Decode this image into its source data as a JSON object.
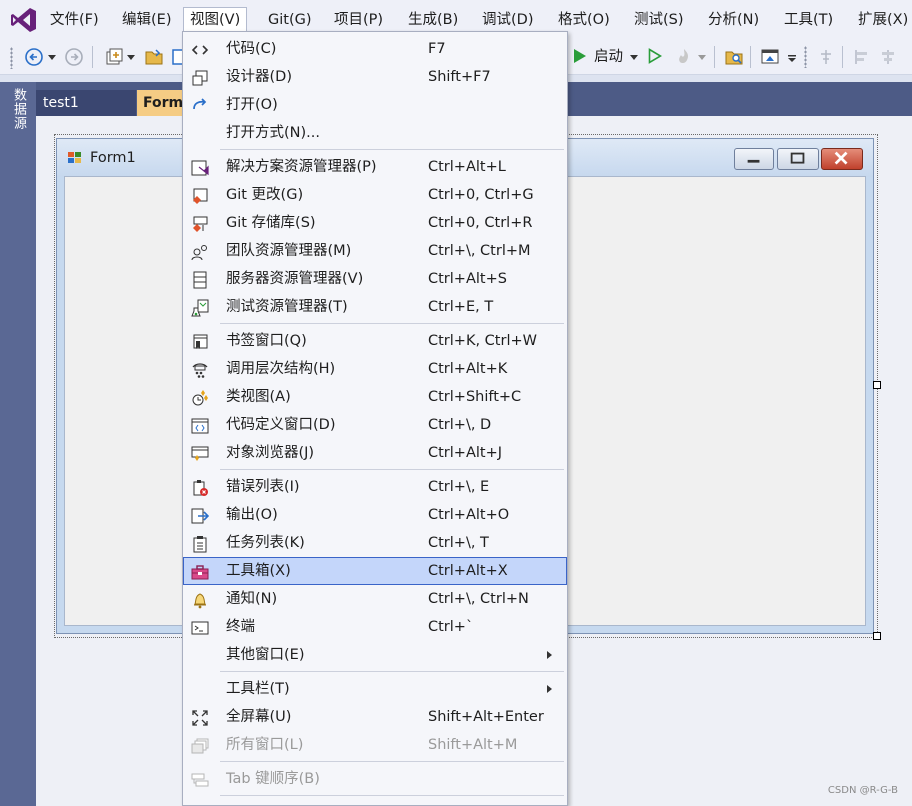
{
  "menubar": {
    "items": [
      "文件(F)",
      "编辑(E)",
      "视图(V)",
      "Git(G)",
      "项目(P)",
      "生成(B)",
      "调试(D)",
      "格式(O)",
      "测试(S)",
      "分析(N)",
      "工具(T)",
      "扩展(X)"
    ],
    "active_index": 2
  },
  "toolbar": {
    "start_label": "启动"
  },
  "left_panel": {
    "datasource_label": "数据源"
  },
  "tabs": {
    "tab1": "test1",
    "tab2": "Form"
  },
  "form": {
    "title": "Form1"
  },
  "view_menu": {
    "items": [
      {
        "label": "代码(C)",
        "shortcut": "F7",
        "icon": "code-icon"
      },
      {
        "label": "设计器(D)",
        "shortcut": "Shift+F7",
        "icon": "designer-icon"
      },
      {
        "label": "打开(O)",
        "shortcut": "",
        "icon": "open-icon"
      },
      {
        "label": "打开方式(N)...",
        "shortcut": "",
        "icon": ""
      },
      {
        "label": "解决方案资源管理器(P)",
        "shortcut": "Ctrl+Alt+L",
        "icon": "solution-explorer-icon"
      },
      {
        "label": "Git 更改(G)",
        "shortcut": "Ctrl+0, Ctrl+G",
        "icon": "git-changes-icon"
      },
      {
        "label": "Git 存储库(S)",
        "shortcut": "Ctrl+0, Ctrl+R",
        "icon": "git-repository-icon"
      },
      {
        "label": "团队资源管理器(M)",
        "shortcut": "Ctrl+\\, Ctrl+M",
        "icon": "team-explorer-icon"
      },
      {
        "label": "服务器资源管理器(V)",
        "shortcut": "Ctrl+Alt+S",
        "icon": "server-explorer-icon"
      },
      {
        "label": "测试资源管理器(T)",
        "shortcut": "Ctrl+E, T",
        "icon": "test-explorer-icon"
      },
      {
        "label": "书签窗口(Q)",
        "shortcut": "Ctrl+K, Ctrl+W",
        "icon": "bookmark-icon"
      },
      {
        "label": "调用层次结构(H)",
        "shortcut": "Ctrl+Alt+K",
        "icon": "call-hierarchy-icon"
      },
      {
        "label": "类视图(A)",
        "shortcut": "Ctrl+Shift+C",
        "icon": "class-view-icon"
      },
      {
        "label": "代码定义窗口(D)",
        "shortcut": "Ctrl+\\, D",
        "icon": "code-definition-icon"
      },
      {
        "label": "对象浏览器(J)",
        "shortcut": "Ctrl+Alt+J",
        "icon": "object-browser-icon"
      },
      {
        "label": "错误列表(I)",
        "shortcut": "Ctrl+\\, E",
        "icon": "error-list-icon"
      },
      {
        "label": "输出(O)",
        "shortcut": "Ctrl+Alt+O",
        "icon": "output-icon"
      },
      {
        "label": "任务列表(K)",
        "shortcut": "Ctrl+\\, T",
        "icon": "task-list-icon"
      },
      {
        "label": "工具箱(X)",
        "shortcut": "Ctrl+Alt+X",
        "icon": "toolbox-icon"
      },
      {
        "label": "通知(N)",
        "shortcut": "Ctrl+\\, Ctrl+N",
        "icon": "notification-bell-icon"
      },
      {
        "label": "终端",
        "shortcut": "Ctrl+`",
        "icon": "terminal-icon"
      },
      {
        "label": "其他窗口(E)",
        "shortcut": "",
        "icon": ""
      },
      {
        "label": "工具栏(T)",
        "shortcut": "",
        "icon": ""
      },
      {
        "label": "全屏幕(U)",
        "shortcut": "Shift+Alt+Enter",
        "icon": "fullscreen-icon"
      },
      {
        "label": "所有窗口(L)",
        "shortcut": "Shift+Alt+M",
        "icon": "all-windows-icon"
      },
      {
        "label": "Tab 键顺序(B)",
        "shortcut": "",
        "icon": "tab-order-icon"
      }
    ],
    "highlighted": "工具箱(X)"
  },
  "watermark": "CSDN @R-G-B",
  "colors": {
    "accent": "#68217a",
    "menu_highlight": "#c4d6fa",
    "tab_active": "#f5cc84",
    "play_green": "#2a9d3a"
  }
}
